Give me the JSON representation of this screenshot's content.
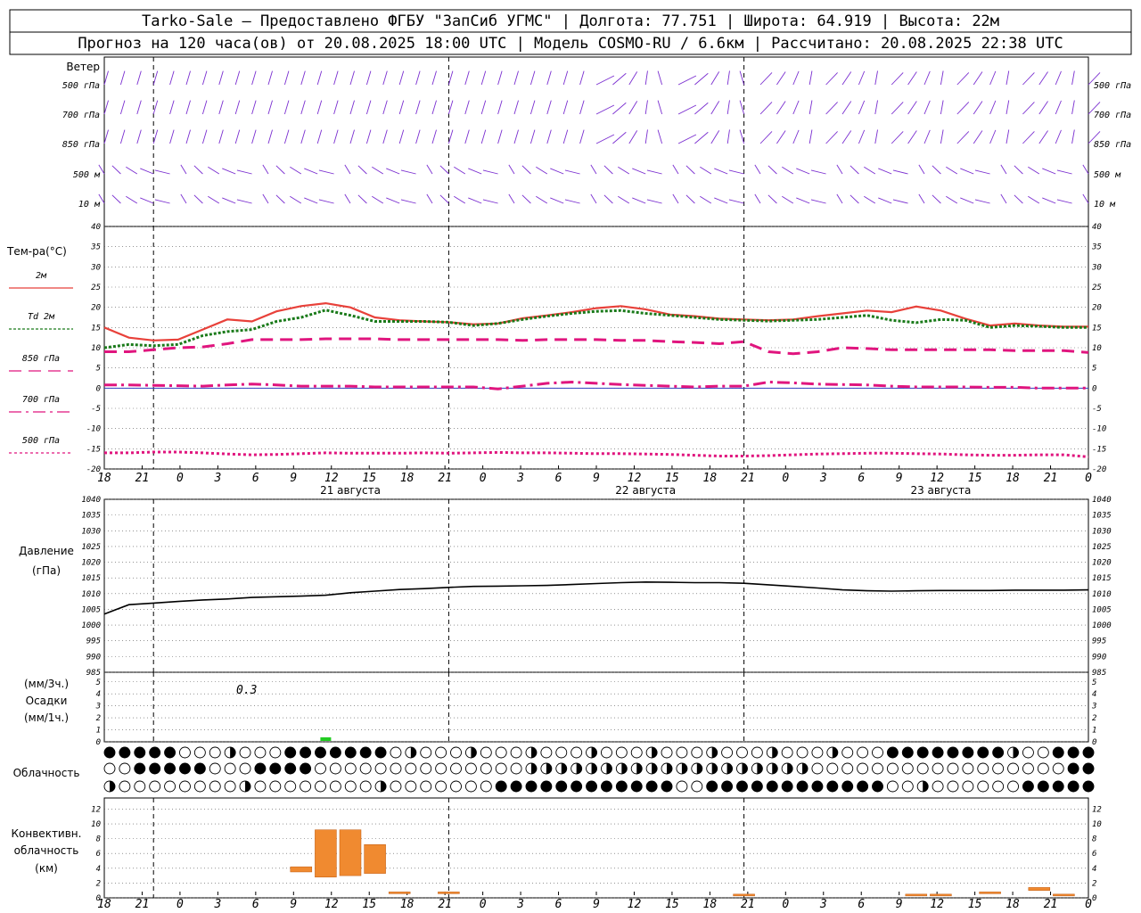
{
  "header": {
    "line1": "Tarko-Sale – Предоставлено ФГБУ \"ЗапСиб УГМС\" | Долгота: 77.751 | Широта: 64.919 | Высота: 22м",
    "line2": "Прогноз на 120 часа(ов) от 20.08.2025 18:00 UTC  | Модель COSMO-RU / 6.6км | Рассчитано: 20.08.2025 22:38 UTC"
  },
  "wind": {
    "title": "Ветер",
    "levels": [
      "500 гПа",
      "700 гПа",
      "850 гПа",
      "500 м",
      "10  м"
    ]
  },
  "temperature": {
    "title": "Тем-ра(°С)",
    "legend": [
      "2м",
      "Td  2м",
      "850 гПа",
      "700 гПа",
      "500 гПа"
    ],
    "colors": [
      "#e8413a",
      "#1a7a1a",
      "#e0157e",
      "#e0157e",
      "#e0157e"
    ]
  },
  "dates": [
    "21 августа",
    "22 августа",
    "23 августа"
  ],
  "x_ticks": [
    "18",
    "21",
    "0",
    "3",
    "6",
    "9",
    "12",
    "15",
    "18",
    "21",
    "0",
    "3",
    "6",
    "9",
    "12",
    "15",
    "18",
    "21",
    "0",
    "3",
    "6",
    "9",
    "12",
    "15",
    "18",
    "21",
    "0"
  ],
  "pressure": {
    "title1": "Давление",
    "title2": "(гПа)"
  },
  "precip": {
    "title1": "(мм/3ч.)",
    "title2": "Осадки",
    "title3": "(мм/1ч.)",
    "annotation": "0.3"
  },
  "clouds": {
    "title": "Облачность"
  },
  "convective": {
    "title1": "Конвективн.",
    "title2": "облачность",
    "title3": "(км)"
  },
  "chart_data": [
    {
      "type": "line",
      "name": "temperature",
      "x_hours": [
        0,
        3,
        6,
        9,
        12,
        15,
        18,
        21,
        24,
        27,
        30,
        33,
        36,
        39,
        42,
        45,
        48,
        51,
        54,
        57,
        60,
        63,
        66,
        69,
        72,
        75,
        78,
        81,
        84,
        87,
        90,
        93,
        96,
        99,
        102,
        105,
        108,
        111,
        114,
        117,
        120
      ],
      "ylim": [
        -20,
        40
      ],
      "yticks": [
        -20,
        -15,
        -10,
        -5,
        0,
        5,
        10,
        15,
        20,
        25,
        30,
        35,
        40
      ],
      "series": [
        {
          "name": "2м",
          "values": [
            15,
            12.5,
            11.8,
            12,
            14.5,
            17,
            16.5,
            19,
            20.3,
            21,
            20,
            17.5,
            16.8,
            16.5,
            16.3,
            15.8,
            16,
            17.3,
            18,
            18.8,
            19.8,
            20.3,
            19.5,
            18.2,
            17.8,
            17.2,
            17,
            16.8,
            17,
            17.8,
            18.5,
            19.2,
            18.8,
            20.2,
            19.2,
            17.2,
            15.5,
            16,
            15.5,
            15.2,
            15.2
          ]
        },
        {
          "name": "Td 2м",
          "values": [
            10,
            10.8,
            10.5,
            10.8,
            13,
            14,
            14.5,
            16.5,
            17.5,
            19.3,
            18,
            16.5,
            16.5,
            16.5,
            16.3,
            15.5,
            16,
            17,
            17.8,
            18.5,
            19,
            19.2,
            18.5,
            18,
            17.5,
            17,
            16.8,
            16.6,
            16.8,
            17,
            17.5,
            18,
            16.8,
            16.2,
            17,
            16.8,
            15,
            15.5,
            15.3,
            15,
            15
          ]
        },
        {
          "name": "850 гПа",
          "values": [
            9,
            9,
            9.5,
            10,
            10.2,
            11,
            12,
            12,
            12,
            12.2,
            12.2,
            12.2,
            12,
            12,
            12,
            12,
            12,
            11.8,
            12,
            12,
            12,
            11.8,
            11.8,
            11.5,
            11.3,
            11,
            11.5,
            9,
            8.5,
            9,
            10,
            9.8,
            9.5,
            9.5,
            9.5,
            9.5,
            9.5,
            9.3,
            9.3,
            9.3,
            8.8
          ]
        },
        {
          "name": "700 гПа",
          "values": [
            0.8,
            0.8,
            0.7,
            0.6,
            0.5,
            0.8,
            1,
            0.8,
            0.5,
            0.5,
            0.5,
            0.3,
            0.3,
            0.3,
            0.3,
            0.3,
            -0.2,
            0.5,
            1.2,
            1.5,
            1.2,
            0.9,
            0.7,
            0.5,
            0.3,
            0.5,
            0.5,
            1.5,
            1.3,
            1,
            0.9,
            0.8,
            0.5,
            0.3,
            0.3,
            0.3,
            0.2,
            0.2,
            0,
            0,
            0
          ]
        },
        {
          "name": "500 гПа",
          "values": [
            -16,
            -16,
            -15.8,
            -15.8,
            -16,
            -16.3,
            -16.5,
            -16.4,
            -16.2,
            -16,
            -16.1,
            -16.1,
            -16.1,
            -16,
            -16.1,
            -16,
            -15.9,
            -16,
            -16,
            -16.1,
            -16.2,
            -16.2,
            -16.3,
            -16.4,
            -16.6,
            -16.8,
            -16.8,
            -16.7,
            -16.5,
            -16.3,
            -16.2,
            -16.1,
            -16.1,
            -16.2,
            -16.3,
            -16.5,
            -16.6,
            -16.6,
            -16.5,
            -16.5,
            -17
          ]
        }
      ]
    },
    {
      "type": "line",
      "name": "pressure",
      "x_hours": [
        0,
        3,
        6,
        9,
        12,
        15,
        18,
        21,
        24,
        27,
        30,
        33,
        36,
        39,
        42,
        45,
        48,
        51,
        54,
        57,
        60,
        63,
        66,
        69,
        72,
        75,
        78,
        81,
        84,
        87,
        90,
        93,
        96,
        99,
        102,
        105,
        108,
        111,
        114,
        117,
        120
      ],
      "ylim": [
        985,
        1040
      ],
      "yticks": [
        985,
        990,
        995,
        1000,
        1005,
        1010,
        1015,
        1020,
        1025,
        1030,
        1035,
        1040
      ],
      "series": [
        {
          "name": "pressure",
          "values": [
            1003.5,
            1006.5,
            1007,
            1007.5,
            1008,
            1008.3,
            1008.8,
            1009,
            1009.2,
            1009.5,
            1010.3,
            1010.8,
            1011.3,
            1011.6,
            1012,
            1012.3,
            1012.4,
            1012.5,
            1012.6,
            1012.9,
            1013.2,
            1013.5,
            1013.7,
            1013.6,
            1013.5,
            1013.5,
            1013.3,
            1012.8,
            1012.3,
            1011.8,
            1011.2,
            1010.9,
            1010.8,
            1010.9,
            1011,
            1011,
            1011,
            1011.1,
            1011.1,
            1011.1,
            1011.2
          ]
        }
      ]
    },
    {
      "type": "bar",
      "name": "precipitation",
      "ylim": [
        0,
        5
      ],
      "yticks": [
        0,
        1,
        2,
        3,
        4,
        5
      ],
      "bars": [
        {
          "x_hour": 27,
          "value": 0.3
        }
      ]
    },
    {
      "type": "bar",
      "name": "convective_cloud",
      "ylim": [
        0,
        13
      ],
      "yticks": [
        0,
        2,
        4,
        6,
        8,
        10,
        12
      ],
      "bars": [
        {
          "x_hour": 24,
          "bottom": 3.5,
          "top": 4.2
        },
        {
          "x_hour": 27,
          "bottom": 2.8,
          "top": 9.2
        },
        {
          "x_hour": 30,
          "bottom": 3.0,
          "top": 9.2
        },
        {
          "x_hour": 33,
          "bottom": 3.3,
          "top": 7.2
        },
        {
          "x_hour": 36,
          "bottom": 0.6,
          "top": 0.8
        },
        {
          "x_hour": 42,
          "bottom": 0.6,
          "top": 0.8
        },
        {
          "x_hour": 78,
          "bottom": 0.4,
          "top": 0.5
        },
        {
          "x_hour": 99,
          "bottom": 0.4,
          "top": 0.5
        },
        {
          "x_hour": 102,
          "bottom": 0.4,
          "top": 0.5
        },
        {
          "x_hour": 108,
          "bottom": 0.6,
          "top": 0.8
        },
        {
          "x_hour": 114,
          "bottom": 1.0,
          "top": 1.4
        },
        {
          "x_hour": 117,
          "bottom": 0.3,
          "top": 0.5
        }
      ]
    }
  ]
}
